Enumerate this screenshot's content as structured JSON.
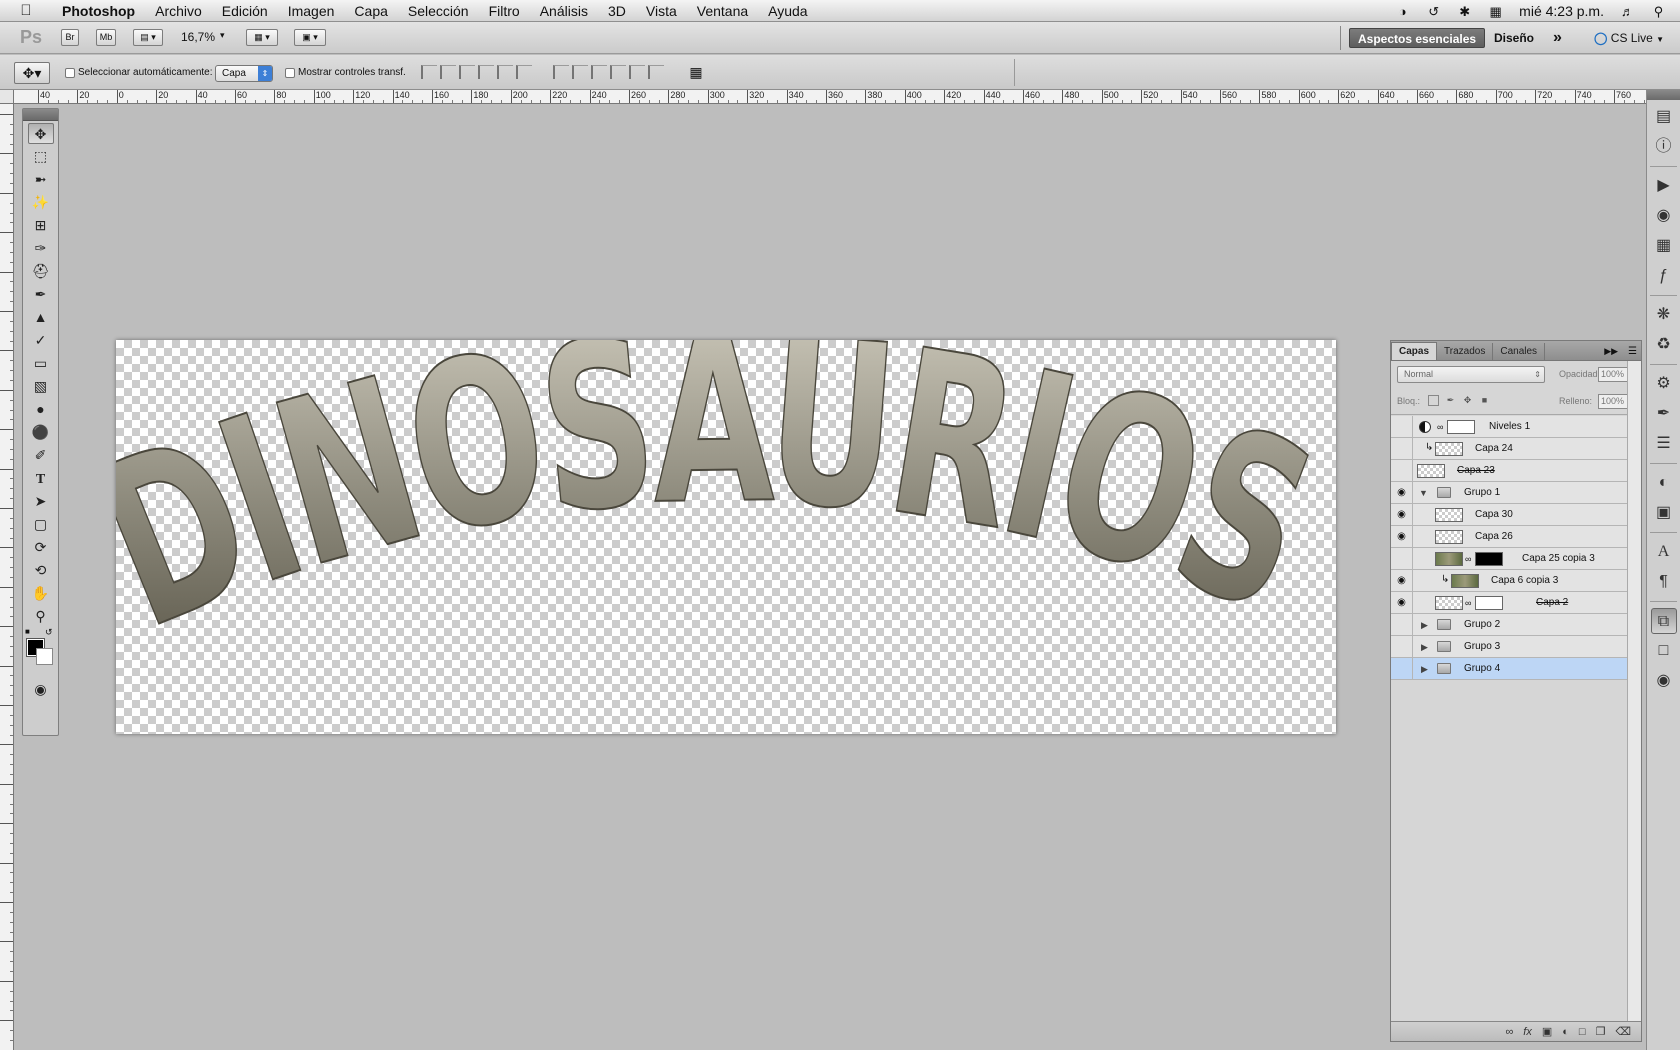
{
  "menubar": {
    "app": "Photoshop",
    "items": [
      "Archivo",
      "Edición",
      "Imagen",
      "Capa",
      "Selección",
      "Filtro",
      "Análisis",
      "3D",
      "Vista",
      "Ventana",
      "Ayuda"
    ],
    "clock": "mié 4:23 p.m."
  },
  "appbar": {
    "ps_logo": "Ps",
    "br": "Br",
    "mb": "Mb",
    "zoom": "16,7%",
    "workspace_active": "Aspectos esenciales",
    "workspace_design": "Diseño",
    "more": "»",
    "cslive": "CS Live"
  },
  "options": {
    "auto_select_label": "Seleccionar automáticamente:",
    "auto_select_value": "Capa",
    "show_transform_label": "Mostrar controles transf."
  },
  "ruler": {
    "top_labels": [
      "40",
      "20",
      "0",
      "20",
      "40",
      "60",
      "80",
      "100",
      "120",
      "140",
      "160",
      "180",
      "200",
      "220",
      "240",
      "260",
      "280",
      "300",
      "320",
      "340",
      "360",
      "380",
      "400",
      "420",
      "440",
      "460",
      "480",
      "500",
      "520",
      "540",
      "560",
      "580",
      "600",
      "620",
      "640",
      "660",
      "680",
      "700",
      "720",
      "740",
      "760"
    ]
  },
  "canvas": {
    "text": "DINOSAURIOS",
    "fill_colors": [
      "#d2cec0",
      "#8d8a7c",
      "#595547"
    ]
  },
  "layers_panel": {
    "tabs": [
      "Capas",
      "Trazados",
      "Canales"
    ],
    "blend_mode": "Normal",
    "opacity_label": "Opacidad:",
    "opacity_value": "100%",
    "lock_label": "Bloq.:",
    "fill_label": "Relleno:",
    "fill_value": "100%",
    "layers": [
      {
        "name": "Niveles 1",
        "visible": false,
        "kind": "adjust",
        "indent": 0,
        "selected": false,
        "struck": false
      },
      {
        "name": "Capa 24",
        "visible": false,
        "kind": "clip",
        "indent": 0,
        "selected": false,
        "struck": false
      },
      {
        "name": "Capa 23",
        "visible": false,
        "kind": "pixel",
        "indent": 0,
        "selected": false,
        "struck": true
      },
      {
        "name": "Grupo 1",
        "visible": true,
        "kind": "group-open",
        "indent": 0,
        "selected": false,
        "struck": false
      },
      {
        "name": "Capa 30",
        "visible": true,
        "kind": "pixel",
        "indent": 1,
        "selected": false,
        "struck": false
      },
      {
        "name": "Capa 26",
        "visible": true,
        "kind": "pixel",
        "indent": 1,
        "selected": false,
        "struck": false
      },
      {
        "name": "Capa 25 copia 3",
        "visible": false,
        "kind": "masked-rock",
        "indent": 1,
        "selected": false,
        "struck": false
      },
      {
        "name": "Capa 6 copia 3",
        "visible": true,
        "kind": "clip-rock",
        "indent": 1,
        "selected": false,
        "struck": false
      },
      {
        "name": "Capa 2",
        "visible": true,
        "kind": "masked",
        "indent": 1,
        "selected": false,
        "struck": true
      },
      {
        "name": "Grupo 2",
        "visible": false,
        "kind": "group",
        "indent": 0,
        "selected": false,
        "struck": false
      },
      {
        "name": "Grupo 3",
        "visible": false,
        "kind": "group",
        "indent": 0,
        "selected": false,
        "struck": false
      },
      {
        "name": "Grupo 4",
        "visible": false,
        "kind": "group",
        "indent": 0,
        "selected": true,
        "struck": false
      }
    ]
  }
}
